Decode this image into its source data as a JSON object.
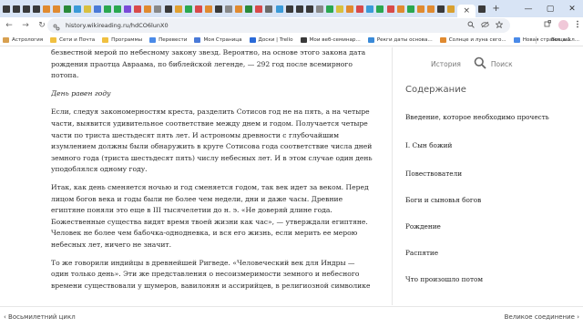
{
  "browser": {
    "tab_colors": [
      "#3a3a3a",
      "#3a3a3a",
      "#3a3a3a",
      "#3a3a3a",
      "#e08a30",
      "#e08a30",
      "#2a8a3a",
      "#3a9ad8",
      "#d8c040",
      "#4a7ad8",
      "#2aa850",
      "#2aa850",
      "#7a4ad8",
      "#d84a4a",
      "#e08a30",
      "#888888",
      "#3a3a3a",
      "#e0a030",
      "#2aa850",
      "#d84a4a",
      "#e08a30",
      "#3a3a3a",
      "#888888",
      "#e08a30",
      "#2a8a3a",
      "#d84a4a",
      "#6a6a6a",
      "#3a9ad8",
      "#3a3a3a",
      "#3a3a3a",
      "#3a3a3a",
      "#888888",
      "#2aa850",
      "#d8c040",
      "#e08a30",
      "#d84a4a",
      "#3a9ad8",
      "#2aa850",
      "#d84a4a",
      "#e08a30",
      "#2aa850",
      "#e08a30",
      "#e08a30",
      "#3a3a3a",
      "#d8a030",
      "#3a3a3a"
    ],
    "active_tab_label": "×",
    "new_tab": "+",
    "window": {
      "minimize": "—",
      "maximize": "▢",
      "close": "✕"
    },
    "nav": {
      "back": "←",
      "forward": "→",
      "reload": "↻",
      "home": "⌂"
    },
    "url": "history.wikireading.ru/hdCO6lunX0"
  },
  "bookmarks": {
    "items": [
      {
        "label": "Астрология",
        "color": "#d8a050"
      },
      {
        "label": "Сети и Почта",
        "color": "#f0c040"
      },
      {
        "label": "Программы",
        "color": "#f0c040"
      },
      {
        "label": "Перевести",
        "color": "#4a8ae8"
      },
      {
        "label": "Моя Страница",
        "color": "#4a7ad8"
      },
      {
        "label": "Доски | Trello",
        "color": "#2a6ad8"
      },
      {
        "label": "Мои веб-семинар...",
        "color": "#3a3a3a"
      },
      {
        "label": "Рекги даты основа...",
        "color": "#3a8ad8"
      },
      {
        "label": "Солнце и луна сего...",
        "color": "#e08a30"
      },
      {
        "label": "Новая страница 1",
        "color": "#4a8ae8"
      }
    ],
    "all_bookmarks": "Все закл..."
  },
  "article": {
    "intro": "безвестной мерой по небесному закону звезд. Вероятно, на основе этого закона дата рождения праотца Авраама, по библейской легенде, — 292 год после всемирного потопа.",
    "subhead": "День равен году",
    "p1": "Если, следуя закономерностям креста, разделить Сотисов год не на пять, а на четыре части, выявится удивительное соответствие между днем и годом. Получается четыре части по триста шестьдесят пять лет. И астрономы древности с глубочайшим изумлением должны были обнаружить в круге Сотисова года соответствие числа дней земного года (триста шестьдесят пять) числу небесных лет. И в этом случае один день уподоблялся одному году.",
    "p2": "Итак, как день сменяется ночью и год сменяется годом, так век идет за веком. Перед лицом богов века и годы были не более чем недели, дни и даже часы. Древние египтяне поняли это еще в III тысячелетии до н. э. «Не доверяй длине года. Божественные существа видят время твоей жизни как час», — утверждали египтяне. Человек не более чем бабочка-однодневка, и вся его жизнь, если мерить ее мерою небесных лет, ничего не значит.",
    "p3": "То же говорили индийцы в древнейшей Ригведе. «Человеческий век для Индры — один только день». Эти же представления о несоизмеримости земного и небесного времени существовали у шумеров, вавилонян и ассирийцев, в религиозной символике"
  },
  "sidebar": {
    "history": "История",
    "search": "Поиск",
    "toc_title": "Содержание",
    "toc": [
      "Введение, которое необходимо прочесть",
      "I. Сын божий",
      "Повествователи",
      "Боги и сыновья богов",
      "Рождение",
      "Распятие",
      "Что произошло потом"
    ]
  },
  "bottom_nav": {
    "prev": "‹  Восьмилетний цикл",
    "next": "Великое соединение  ›"
  }
}
